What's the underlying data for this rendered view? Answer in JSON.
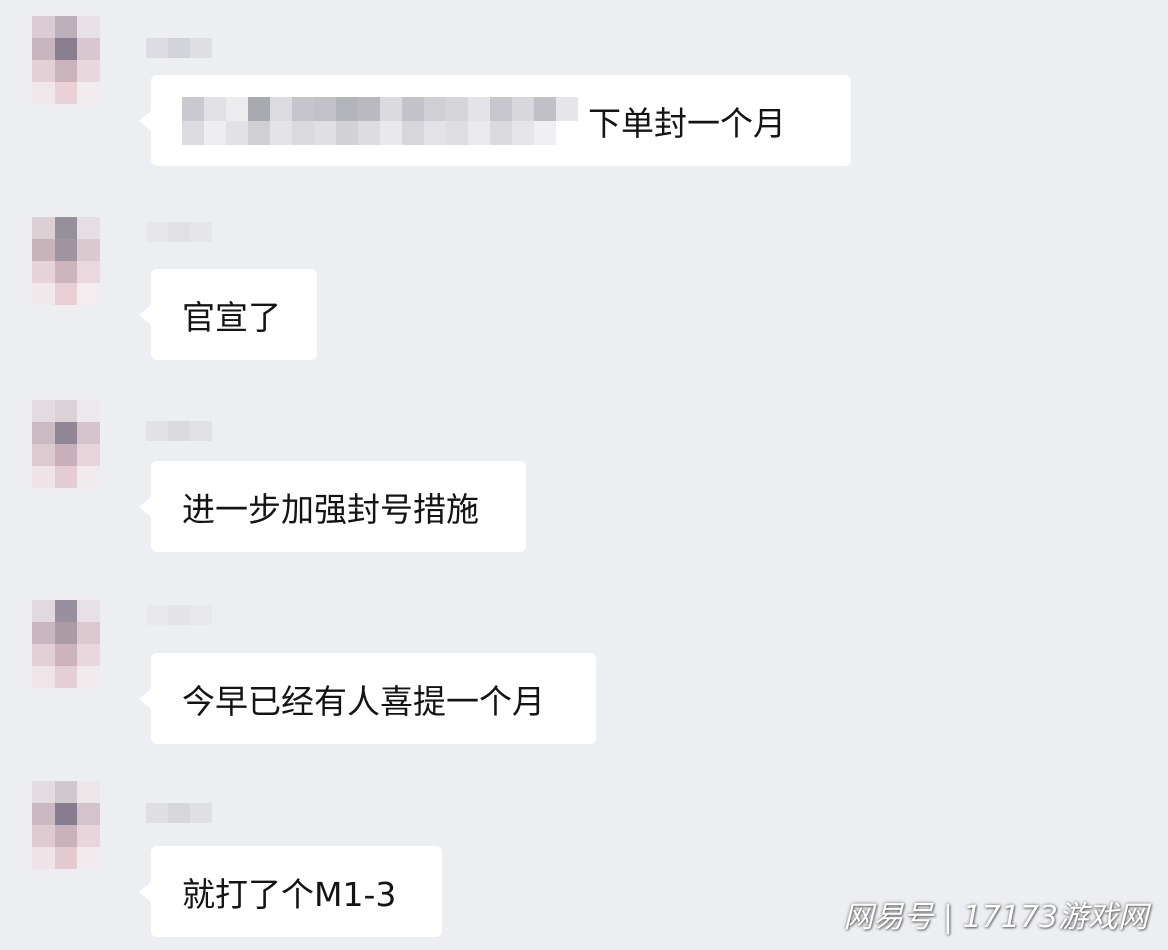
{
  "chat": {
    "messages": [
      {
        "text": "下单封一个月",
        "has_redacted_prefix": true
      },
      {
        "text": "官宣了"
      },
      {
        "text": "进一步加强封号措施"
      },
      {
        "text": "今早已经有人喜提一个月"
      },
      {
        "text": "就打了个M1-3"
      }
    ]
  },
  "watermark": {
    "text": "网易号 | 17173游戏网"
  },
  "colors": {
    "background": "#edeef2",
    "bubble": "#ffffff",
    "text": "#141414"
  }
}
